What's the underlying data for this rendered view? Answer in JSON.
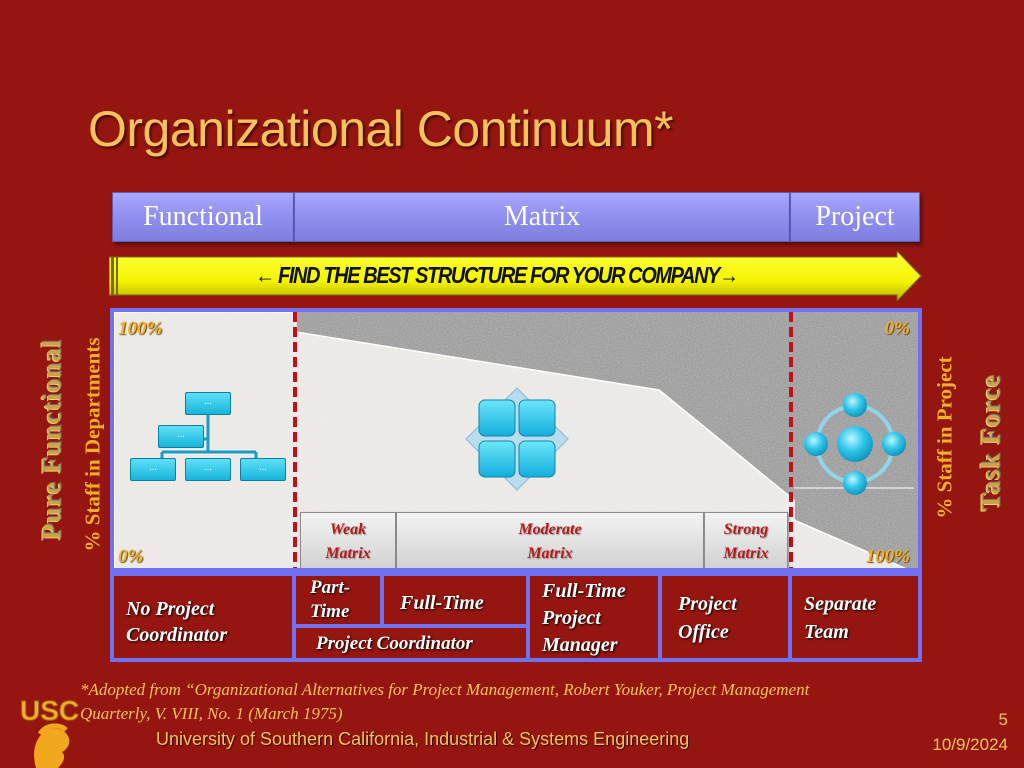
{
  "slide": {
    "title": "Organizational Continuum*",
    "bands": {
      "functional": "Functional",
      "matrix": "Matrix",
      "project": "Project"
    },
    "arrow_banner": "← FIND THE BEST STRUCTURE FOR YOUR COMPANY→",
    "side_labels": {
      "left_outer": "Pure Functional",
      "left_inner": "% Staff in Departments",
      "right_inner": "% Staff in Project",
      "right_outer": "Task Force"
    },
    "percent_labels": {
      "top_left": "100%",
      "bottom_left": "0%",
      "top_right": "0%",
      "bottom_right": "100%"
    },
    "matrix_types": [
      {
        "label": "Weak\nMatrix"
      },
      {
        "label": "Moderate\nMatrix"
      },
      {
        "label": "Strong\nMatrix"
      }
    ],
    "diagram_icons": {
      "functional": "org-chart-icon",
      "matrix": "matrix-grid-icon",
      "project": "hub-cycle-icon",
      "box_text": "..."
    },
    "coordination_cells": {
      "no_coordinator": "No Project\nCoordinator",
      "part_time": "Part-\nTime",
      "full_time": "Full-Time",
      "project_coordinator": "Project Coordinator",
      "full_time_pm": "Full-Time\nProject\nManager",
      "project_office": "Project\nOffice",
      "separate_team": "Separate\nTeam"
    },
    "footnote": "*Adopted from “Organizational Alternatives for Project Management, Robert Youker, Project Management Quarterly, V. VIII, No. 1 (March 1975)",
    "footer": {
      "institution": "University of Southern California, Industrial & Systems Engineering",
      "page_number": "5",
      "date": "10/9/2024",
      "logo_text": "USC"
    },
    "colors": {
      "background": "#951610",
      "title": "#f6c35a",
      "band": "#9191f0",
      "frame": "#7070f0",
      "arrow": "#ffff1a",
      "matrix_text": "#b51a1a"
    }
  }
}
